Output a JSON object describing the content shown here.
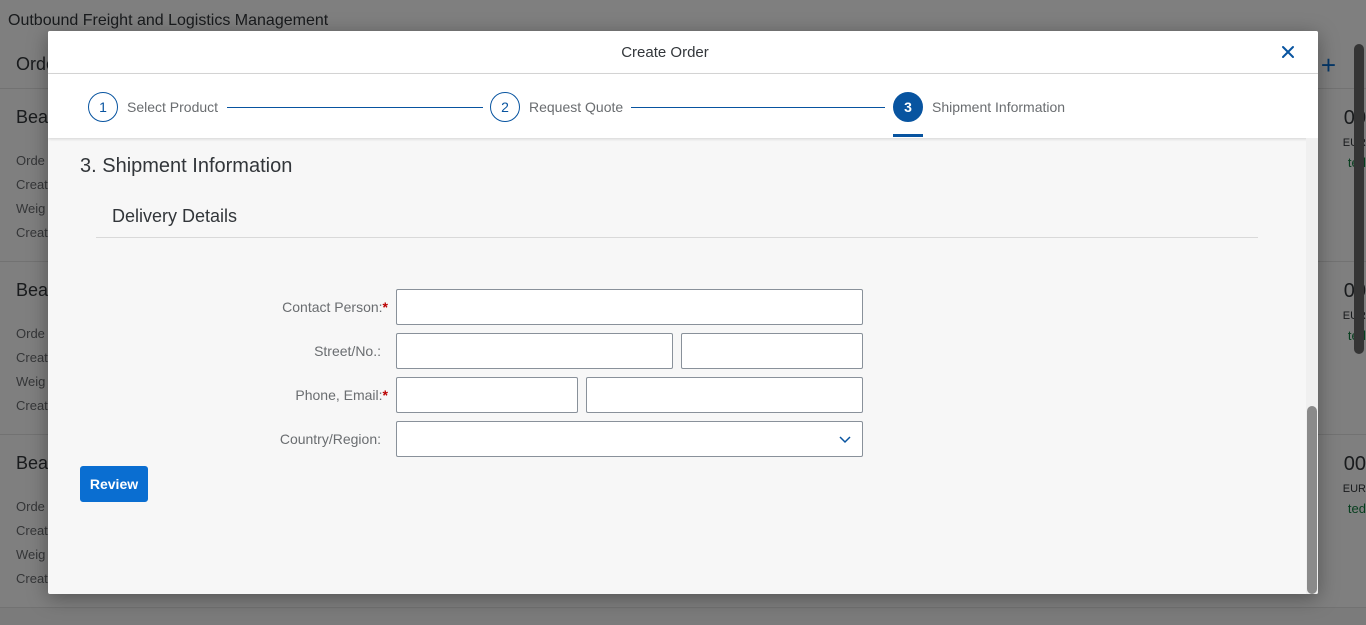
{
  "background": {
    "shell_title": "Outbound Freight and Logistics Management",
    "header_title": "Orde",
    "cards": [
      {
        "title": "Bea",
        "lines": [
          "Orde",
          "Creat",
          "Weig",
          "Creat"
        ],
        "amount": "00",
        "currency": "EUR",
        "status": "ted"
      },
      {
        "title": "Bea",
        "lines": [
          "Orde",
          "Creat",
          "Weig",
          "Creat"
        ],
        "amount": "00",
        "currency": "EUR",
        "status": "ted"
      },
      {
        "title": "Bea",
        "lines": [
          "Orde",
          "Creat",
          "Weig",
          "Creat"
        ],
        "amount": "00",
        "currency": "EUR",
        "status": "ted"
      }
    ]
  },
  "dialog": {
    "title": "Create Order",
    "close_icon": "close-icon",
    "wizard": {
      "steps": [
        {
          "number": "1",
          "label": "Select Product"
        },
        {
          "number": "2",
          "label": "Request Quote"
        },
        {
          "number": "3",
          "label": "Shipment Information"
        }
      ],
      "active_step": 3
    },
    "section_title": "3. Shipment Information",
    "subsection_title": "Delivery Details",
    "form": {
      "contact_person_label": "Contact Person:",
      "street_label": "Street/No.:",
      "phone_email_label": "Phone, Email:",
      "country_label": "Country/Region:",
      "required_marker": "*",
      "contact_person_value": "",
      "street_value": "",
      "street_no_value": "",
      "phone_value": "",
      "email_value": "",
      "country_value": ""
    },
    "review_button": "Review"
  },
  "colors": {
    "accent": "#0854a0",
    "button": "#0a6ed1",
    "required": "#bb0000",
    "positive": "#107e3e"
  }
}
